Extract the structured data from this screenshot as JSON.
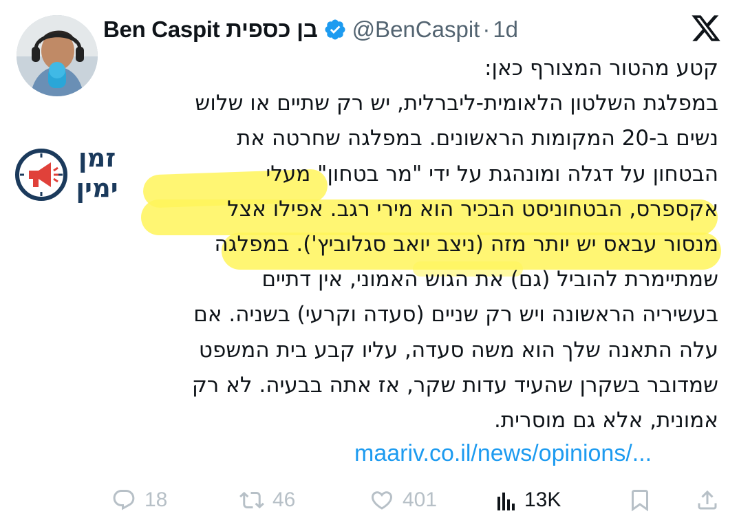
{
  "author": {
    "name": "Ben Caspit בן כספית",
    "handle": "@BenCaspit",
    "separator": "·",
    "time": "1d"
  },
  "tweet": {
    "lines": [
      "קטע מהטור המצורף כאן:",
      "במפלגת השלטון הלאומית-ליברלית, יש רק שתיים או שלוש",
      "נשים ב-20 המקומות הראשונים. במפלגה שחרטה את",
      "הבטחון על דגלה ומונהגת על ידי \"מר בטחון\" מעלי",
      "אקספרס, הבטחוניסט הבכיר הוא מירי רגב. אפילו אצל",
      "מנסור עבאס יש יותר מזה (ניצב יואב סגלוביץ'). במפלגה",
      "שמתיימרת להוביל (גם) את הגוש האמוני, אין דתיים",
      "בעשיריה הראשונה ויש רק שניים (סעדה וקרעי) בשניה. אם",
      "עלה התאנה שלך הוא משה סעדה, עליו קבע בית המשפט",
      "שמדובר בשקרן שהעיד עדות שקר, אז אתה בבעיה. לא רק",
      "אמונית, אלא גם מוסרית."
    ],
    "link": "maariv.co.il/news/opinions/..."
  },
  "watermark": {
    "line1": "זמן",
    "line2": "ימין"
  },
  "actions": {
    "replies": "18",
    "reposts": "46",
    "likes": "401",
    "views": "13K"
  },
  "colors": {
    "link": "#1d9bf0",
    "highlight": "#fff55a",
    "verified": "#1d9bf0",
    "watermark": "#1b3a5c",
    "watermark_accent": "#e0413a"
  },
  "icons": [
    "x-logo-icon",
    "verified-badge-icon",
    "reply-icon",
    "repost-icon",
    "like-icon",
    "views-icon",
    "bookmark-icon",
    "share-icon",
    "megaphone-clock-icon"
  ]
}
